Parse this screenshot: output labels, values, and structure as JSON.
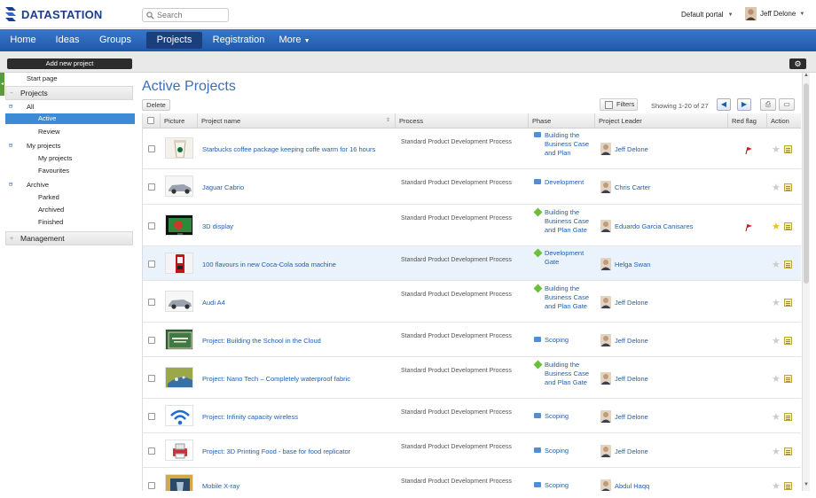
{
  "app": {
    "brand": "DATASTATION",
    "search_placeholder": "Search",
    "portal": "Default portal",
    "user": "Jeff Delone"
  },
  "nav": {
    "items": [
      {
        "label": "Home"
      },
      {
        "label": "Ideas"
      },
      {
        "label": "Groups"
      },
      {
        "label": "Projects"
      },
      {
        "label": "Registration"
      },
      {
        "label": "More"
      }
    ],
    "active": "Projects"
  },
  "toolbar": {
    "add_project": "Add new project"
  },
  "sidebar": {
    "start_page": "Start page",
    "projects": "Projects",
    "all": "All",
    "active": "Active",
    "review": "Review",
    "my_projects_group": "My projects",
    "my_projects": "My projects",
    "favourites": "Favourites",
    "archive": "Archive",
    "parked": "Parked",
    "archived": "Archived",
    "finished": "Finished",
    "management": "Management"
  },
  "main": {
    "title": "Active Projects",
    "delete": "Delete",
    "filters": "Filters",
    "showing": "Showing 1-20 of 27"
  },
  "table": {
    "headers": {
      "picture": "Picture",
      "name": "Project name",
      "process": "Process",
      "phase": "Phase",
      "leader": "Project Leader",
      "flag": "Red flag",
      "action": "Action"
    },
    "rows": [
      {
        "name": "Starbucks coffee package keeping coffe warm for 16 hours",
        "process": "Standard Product Development Process",
        "phase": "Building the Business Case and Plan",
        "phase_icon": "bar-icon",
        "leader": "Jeff Delone",
        "flag": true,
        "star": false,
        "thumb": "coffee-cup-icon"
      },
      {
        "name": "Jaguar Cabrio",
        "process": "Standard Product Development Process",
        "phase": "Development",
        "phase_icon": "bar-icon",
        "leader": "Chris Carter",
        "flag": false,
        "star": false,
        "thumb": "car-icon"
      },
      {
        "name": "3D display",
        "process": "Standard Product Development Process",
        "phase": "Building the Business Case and Plan Gate",
        "phase_icon": "diamond-icon",
        "leader": "Eduardo Garcia Canisares",
        "flag": true,
        "star": true,
        "thumb": "display-icon"
      },
      {
        "name": "100 flavours in new Coca-Cola soda machine",
        "process": "Standard Product Development Process",
        "phase": "Development Gate",
        "phase_icon": "diamond-icon",
        "leader": "Helga Swan",
        "flag": false,
        "star": false,
        "thumb": "soda-machine-icon"
      },
      {
        "name": "Audi A4",
        "process": "Standard Product Development Process",
        "phase": "Building the Business Case and Plan Gate",
        "phase_icon": "diamond-icon",
        "leader": "Jeff Delone",
        "flag": false,
        "star": false,
        "thumb": "car-icon"
      },
      {
        "name": "Project: Building the School in the Cloud",
        "process": "Standard Product Development Process",
        "phase": "Scoping",
        "phase_icon": "bar-icon",
        "leader": "Jeff Delone",
        "flag": false,
        "star": false,
        "thumb": "chalkboard-icon"
      },
      {
        "name": "Project: Nano Tech – Completely waterproof fabric",
        "process": "Standard Product Development Process",
        "phase": "Building the Business Case and Plan Gate",
        "phase_icon": "diamond-icon",
        "leader": "Jeff Delone",
        "flag": false,
        "star": false,
        "thumb": "fabric-icon"
      },
      {
        "name": "Project: Infinity capacity wireless",
        "process": "Standard Product Development Process",
        "phase": "Scoping",
        "phase_icon": "bar-icon",
        "leader": "Jeff Delone",
        "flag": false,
        "star": false,
        "thumb": "wireless-icon"
      },
      {
        "name": "Project: 3D Printing Food - base for food replicator",
        "process": "Standard Product Development Process",
        "phase": "Scoping",
        "phase_icon": "bar-icon",
        "leader": "Jeff Delone",
        "flag": false,
        "star": false,
        "thumb": "printer-icon"
      },
      {
        "name": "Mobile X-ray",
        "process": "Standard Product Development Process",
        "phase": "Scoping",
        "phase_icon": "bar-icon",
        "leader": "Abdul Haqq",
        "flag": false,
        "star": false,
        "thumb": "xray-icon"
      }
    ]
  },
  "colors": {
    "brand": "#1c3e8c",
    "nav": "#2a66b8",
    "link": "#1e5fb2",
    "selected": "#3d8ad6"
  }
}
